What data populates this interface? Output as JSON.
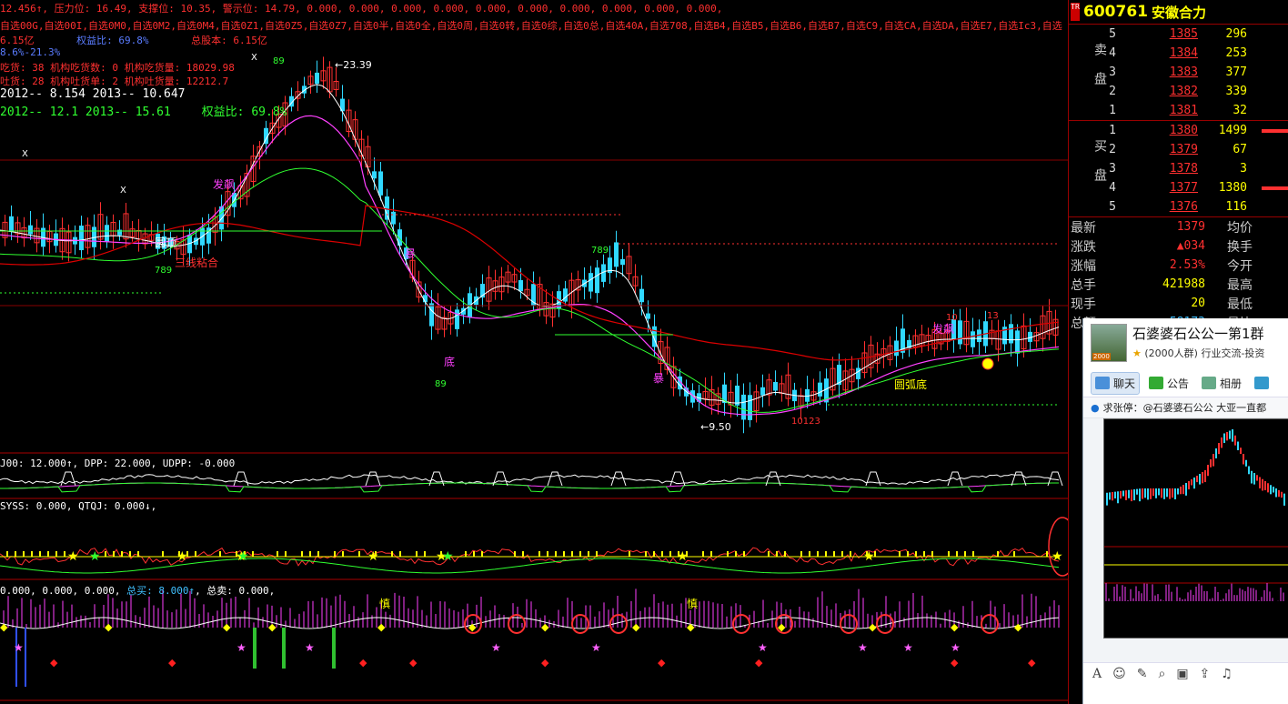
{
  "header_lines": {
    "line1": "12.456↑, 压力位: 16.49, 支撑位: 10.35, 警示位: 14.79, 0.000, 0.000, 0.000, 0.000, 0.000, 0.000, 0.000, 0.000, 0.000, 0.000,",
    "line2": "自选00G,自选00I,自选0M0,自选0M2,自选0M4,自选0Z1,自选0Z5,自选0Z7,自选0半,自选0全,自选0周,自选0转,自选0综,自选0总,自选40A,自选708,自选B4,自选B5,自选B6,自选B7,自选C9,自选CA,自选DA,自选E7,自选Ic3,自选",
    "line3a": "6.15亿",
    "line3b": "权益比: 69.8%",
    "line3c": "总股本: 6.15亿",
    "line4": "8.6%-21.3%",
    "line5": "吃货: 38     机构吃货数: 0     机构吃货量: 18029.98",
    "line6": "吐货: 28     机构吐货单: 2     机构吐货量: 12212.7",
    "line7": "2012-- 8.154    2013-- 10.647",
    "line8a": "2012-- 12.1     2013-- 15.61",
    "line8b": "权益比: 69.8%"
  },
  "annotations": {
    "high_price": "23.39",
    "low_price": "9.50",
    "pattern_1": "圆顶",
    "pattern_2": "三线粘合",
    "pattern_3": "圆弧底",
    "signal_fa": "发飙",
    "signal_lo": "底",
    "signal_bao": "暴",
    "signal_sheng": "慎"
  },
  "indicators": {
    "ind1": "J00: 12.000↑, DPP: 22.000, UDPP: -0.000",
    "ind2": "SYSS: 0.000, QTQJ: 0.000↓,",
    "ind3a": "0.000, 0.000, 0.000, ",
    "ind3b": "总买: 8.000↑",
    "ind3c": ", 总卖: 0.000,"
  },
  "stock": {
    "code": "600761",
    "name": "安徽合力",
    "badge": "TR"
  },
  "order_book": {
    "sell_label": "卖盘",
    "buy_label": "买盘",
    "sell": [
      {
        "level": "5",
        "price": "1385",
        "volume": "296"
      },
      {
        "level": "4",
        "price": "1384",
        "volume": "253"
      },
      {
        "level": "3",
        "price": "1383",
        "volume": "377"
      },
      {
        "level": "2",
        "price": "1382",
        "volume": "339"
      },
      {
        "level": "1",
        "price": "1381",
        "volume": "32"
      }
    ],
    "buy": [
      {
        "level": "1",
        "price": "1380",
        "volume": "1499",
        "bar": 0.24
      },
      {
        "level": "2",
        "price": "1379",
        "volume": "67",
        "bar": 0
      },
      {
        "level": "3",
        "price": "1378",
        "volume": "3",
        "bar": 0
      },
      {
        "level": "4",
        "price": "1377",
        "volume": "1380",
        "bar": 0.22
      },
      {
        "level": "5",
        "price": "1376",
        "volume": "116",
        "bar": 0
      }
    ]
  },
  "stats": [
    {
      "label": "最新",
      "value": "1379",
      "color": "#ff3030",
      "label2": "均价"
    },
    {
      "label": "涨跌",
      "value": "▲034",
      "color": "#ff3030",
      "label2": "换手"
    },
    {
      "label": "涨幅",
      "value": "2.53%",
      "color": "#ff3030",
      "label2": "今开"
    },
    {
      "label": "总手",
      "value": "421988",
      "color": "#ffff00",
      "label2": "最高"
    },
    {
      "label": "现手",
      "value": "20",
      "color": "#ffff00",
      "label2": "最低"
    },
    {
      "label": "总额",
      "value": "58173",
      "color": "#40c0ff",
      "label2": "量比"
    }
  ],
  "qq_group": {
    "title": "石婆婆石公公一第1群",
    "members": "(2000人群)",
    "category": "行业交流-投资",
    "avatar_tag": "2000",
    "tabs": [
      "聊天",
      "公告",
      "相册"
    ],
    "message": "求张停：@石婆婆石公公  大亚一直都"
  },
  "colors": {
    "up": "#ff3030",
    "down": "#40e0ff",
    "ma_white": "#ffffff",
    "ma_magenta": "#ff40ff",
    "ma_green": "#30ff30",
    "ma_red": "#dd0000"
  }
}
